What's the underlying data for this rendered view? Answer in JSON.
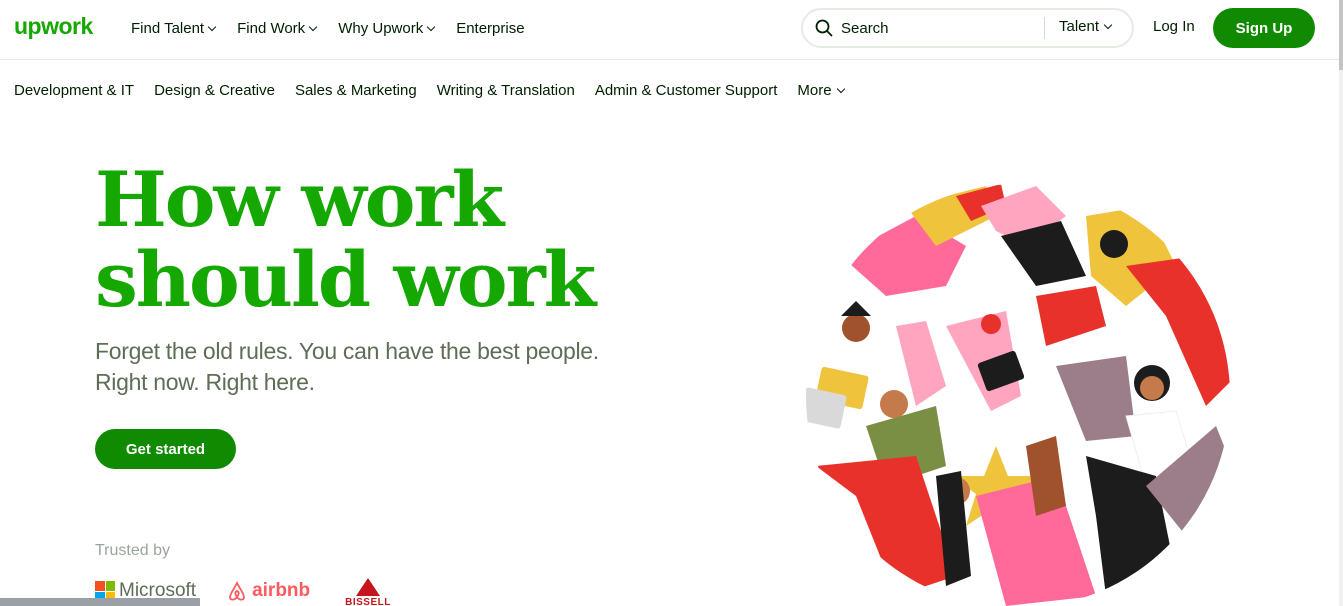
{
  "brand": {
    "logo_text": "upwork",
    "accent": "#14a800",
    "button_green": "#108a00"
  },
  "nav": {
    "items": [
      {
        "label": "Find Talent",
        "has_dropdown": true
      },
      {
        "label": "Find Work",
        "has_dropdown": true
      },
      {
        "label": "Why Upwork",
        "has_dropdown": true
      },
      {
        "label": "Enterprise",
        "has_dropdown": false
      }
    ]
  },
  "search": {
    "placeholder": "Search",
    "scope": "Talent",
    "icon": "search-icon"
  },
  "auth": {
    "login_label": "Log In",
    "signup_label": "Sign Up"
  },
  "categories": [
    {
      "label": "Development & IT"
    },
    {
      "label": "Design & Creative"
    },
    {
      "label": "Sales & Marketing"
    },
    {
      "label": "Writing & Translation"
    },
    {
      "label": "Admin & Customer Support"
    },
    {
      "label": "More",
      "has_dropdown": true
    }
  ],
  "hero": {
    "title_line1": "How work",
    "title_line2": "should work",
    "subtitle_line1": "Forget the old rules. You can have the best people.",
    "subtitle_line2": "Right now. Right here.",
    "cta_label": "Get started"
  },
  "trusted": {
    "label": "Trusted by",
    "logos": [
      {
        "name": "Microsoft",
        "text": "Microsoft"
      },
      {
        "name": "airbnb",
        "text": "airbnb"
      },
      {
        "name": "Bissell",
        "text": "BISSELL"
      }
    ]
  }
}
